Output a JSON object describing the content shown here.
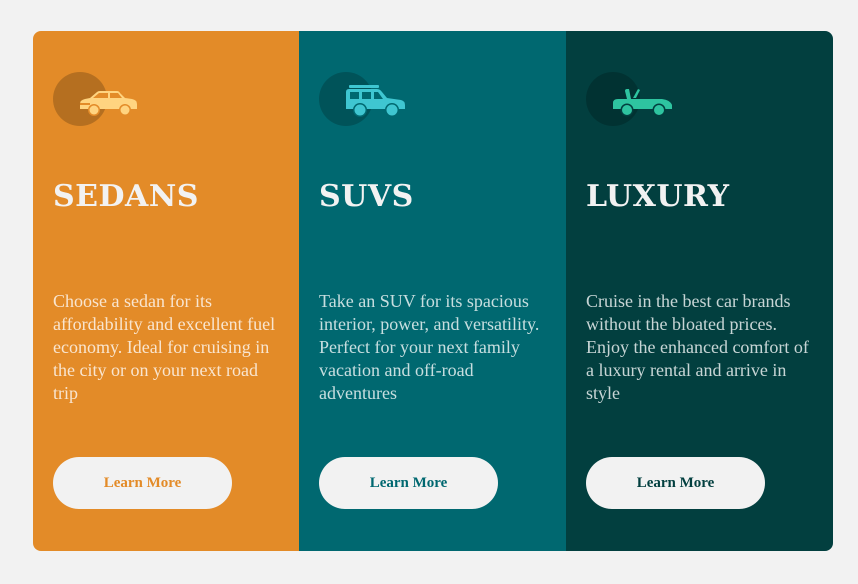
{
  "cards": [
    {
      "icon": "sedan-car-icon",
      "title": "SEDANS",
      "description": "Choose a sedan for its affordability and excellent fuel economy. Ideal for cruising in the city or on your next road trip",
      "button_label": "Learn More",
      "background": "#e38b28",
      "icon_color": "#ffd480"
    },
    {
      "icon": "suv-car-icon",
      "title": "SUVS",
      "description": "Take an SUV for its spacious interior, power, and versatility. Perfect for your next family vacation and off-road adventures",
      "button_label": "Learn More",
      "background": "#006870",
      "icon_color": "#3fc6d1"
    },
    {
      "icon": "convertible-car-icon",
      "title": "LUXURY",
      "description": "Cruise in the best car brands without the bloated prices. Enjoy the enhanced comfort of a luxury rental and arrive in style",
      "button_label": "Learn More",
      "background": "#023f3f",
      "icon_color": "#2ec4a0"
    }
  ]
}
